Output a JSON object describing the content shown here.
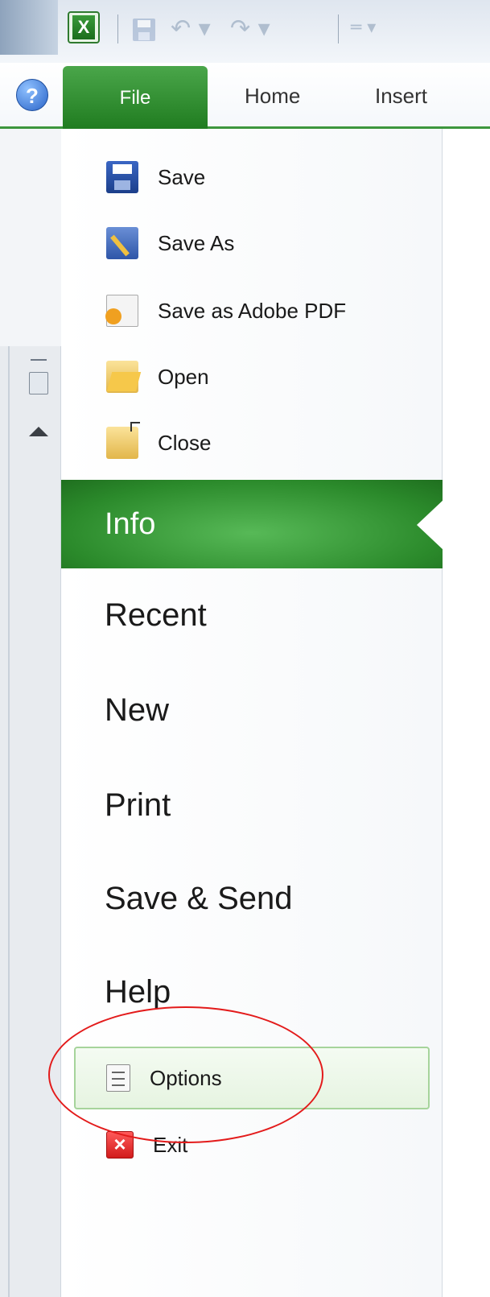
{
  "quick_access": {
    "app_icon": "excel-icon",
    "items": [
      "save-icon",
      "undo-icon",
      "redo-icon",
      "customize-icon"
    ]
  },
  "ribbon": {
    "help_icon": "help-icon",
    "tabs": [
      {
        "label": "File",
        "active": true
      },
      {
        "label": "Home"
      },
      {
        "label": "Insert"
      }
    ]
  },
  "backstage": {
    "commands": [
      {
        "label": "Save",
        "icon": "save-icon"
      },
      {
        "label": "Save As",
        "icon": "save-as-icon"
      },
      {
        "label": "Save as Adobe PDF",
        "icon": "pdf-icon"
      },
      {
        "label": "Open",
        "icon": "folder-open-icon"
      },
      {
        "label": "Close",
        "icon": "folder-close-icon"
      }
    ],
    "tabs": [
      {
        "label": "Info",
        "selected": true
      },
      {
        "label": "Recent"
      },
      {
        "label": "New"
      },
      {
        "label": "Print"
      },
      {
        "label": "Save & Send"
      },
      {
        "label": "Help"
      }
    ],
    "footer_commands": [
      {
        "label": "Options",
        "icon": "options-icon",
        "highlighted": true
      },
      {
        "label": "Exit",
        "icon": "exit-icon"
      }
    ]
  },
  "colors": {
    "accent_green": "#2b8a2b",
    "annotation_red": "#e31b1b"
  }
}
